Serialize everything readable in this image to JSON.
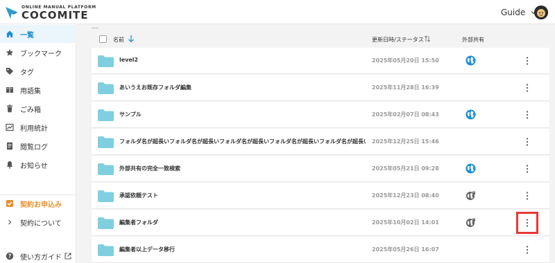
{
  "header": {
    "logo_sub": "ONLINE MANUAL PLATFORM",
    "logo_main": "COCOMITE",
    "user_label": "Guide"
  },
  "sidebar": {
    "items": [
      {
        "label": "一覧",
        "icon": "home-icon",
        "active": true
      },
      {
        "label": "ブックマーク",
        "icon": "star-icon"
      },
      {
        "label": "タグ",
        "icon": "tag-icon"
      },
      {
        "label": "用語集",
        "icon": "book-icon"
      },
      {
        "label": "ごみ箱",
        "icon": "trash-icon"
      },
      {
        "label": "利用統計",
        "icon": "chart-icon"
      },
      {
        "label": "閲覧ログ",
        "icon": "document-icon"
      },
      {
        "label": "お知らせ",
        "icon": "bell-icon"
      }
    ],
    "contract_apply": "契約お申込み",
    "contract_about": "契約について",
    "guide": "使い方ガイド"
  },
  "table": {
    "col_name": "名前",
    "col_date": "更新日時/ステータス",
    "col_share": "外部共有",
    "rows": [
      {
        "name": "level2",
        "date": "2025年05月20日 15:50",
        "share": "public"
      },
      {
        "name": "あいうえお既存フォルダ編集",
        "date": "2025年11月28日 16:39",
        "share": "none"
      },
      {
        "name": "サンプル",
        "date": "2025年02月07日 08:43",
        "share": "public"
      },
      {
        "name": "フォルダ名が超長いフォルダ名が超長いフォルダ名が超長いフォルダ名が超長いフォルダ名が超長い…",
        "date": "2025年12月25日 15:46",
        "share": "none"
      },
      {
        "name": "外部共有の完全一致検索",
        "date": "2025年05月21日 09:28",
        "share": "public"
      },
      {
        "name": "承認依頼テスト",
        "date": "2025年12月23日 08:40",
        "share": "locked"
      },
      {
        "name": "編集者フォルダ",
        "date": "2025年10月02日 14:01",
        "share": "locked"
      },
      {
        "name": "編集者以上データ移行",
        "date": "2025年05月26日 16:07",
        "share": "none"
      }
    ]
  },
  "colors": {
    "accent": "#1b8fd9",
    "folder": "#7fcfe0",
    "orange": "#e8902b",
    "highlight": "#e53935"
  }
}
